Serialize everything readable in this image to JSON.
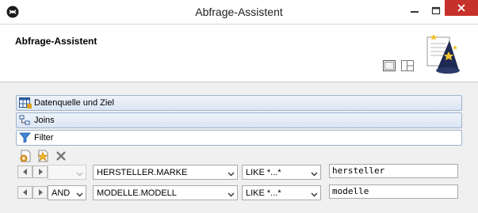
{
  "window": {
    "title": "Abfrage-Assistent",
    "close_color": "#c7312b"
  },
  "header": {
    "title": "Abfrage-Assistent"
  },
  "sections": [
    {
      "label": "Datenquelle und Ziel",
      "icon": "table-icon"
    },
    {
      "label": "Joins",
      "icon": "joins-icon"
    },
    {
      "label": "Filter",
      "icon": "filter-icon"
    }
  ],
  "toolbar": {
    "icons": [
      "add-filter-icon",
      "add-filter-star-icon",
      "delete-icon"
    ]
  },
  "filters": [
    {
      "logic": "",
      "field": "HERSTELLER.MARKE",
      "operator": "LIKE *...*",
      "value": "hersteller"
    },
    {
      "logic": "AND",
      "field": "MODELLE.MODELL",
      "operator": "LIKE *...*",
      "value": "modelle"
    }
  ]
}
